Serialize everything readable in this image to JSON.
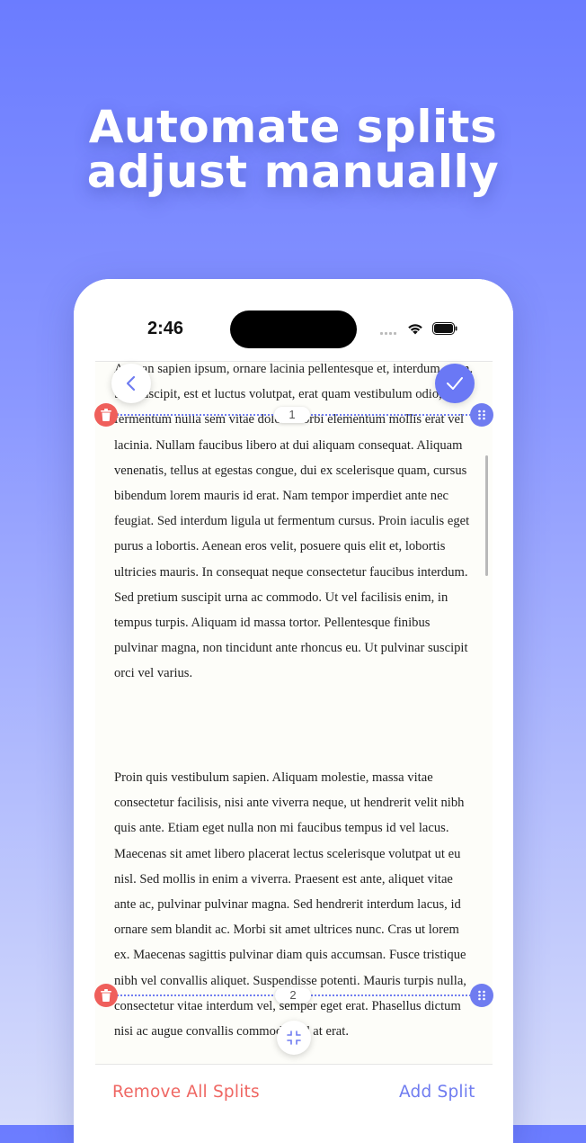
{
  "headline": {
    "line1": "Automate splits",
    "line2": "adjust manually"
  },
  "status_bar": {
    "time": "2:46"
  },
  "document": {
    "paragraph1": "Aenean sapien ipsum, ornare lacinia pellentesque et, interdum enim. Sed suscipit, est et luctus volutpat, erat quam vestibulum odio, et fermentum nulla sem vitae dolor. Morbi elementum mollis erat vel lacinia. Nullam faucibus libero at dui aliquam consequat. Aliquam venenatis, tellus at egestas congue, dui ex scelerisque quam, cursus bibendum lorem mauris id erat. Nam tempor imperdiet ante nec feugiat. Sed interdum ligula ut fermentum cursus. Proin iaculis eget purus a lobortis. Aenean eros velit, posuere quis elit et, lobortis ultricies mauris. In consequat neque consectetur faucibus interdum. Sed pretium suscipit urna ac commodo. Ut vel facilisis enim, in tempus turpis. Aliquam id massa tortor. Pellentesque finibus pulvinar magna, non tincidunt ante rhoncus eu. Ut pulvinar suscipit orci vel varius.",
    "paragraph2": "Proin quis vestibulum sapien. Aliquam molestie, massa vitae consectetur facilisis, nisi ante viverra neque, ut hendrerit velit nibh quis ante. Etiam eget nulla non mi faucibus tempus id vel lacus. Maecenas sit amet libero placerat lectus scelerisque volutpat ut eu nisl. Sed mollis in enim a viverra. Praesent est ante, aliquet vitae ante ac, pulvinar pulvinar magna. Sed hendrerit interdum lacus, id ornare sem blandit ac. Morbi sit amet ultrices nunc. Cras ut lorem ex. Maecenas sagittis pulvinar diam quis accumsan. Fusce tristique nibh vel convallis aliquet. Suspendisse potenti. Mauris turpis nulla, consectetur vitae interdum vel, semper eget erat. Phasellus dictum nisi ac augue convallis commodo sed at erat."
  },
  "splits": [
    {
      "number": "1"
    },
    {
      "number": "2"
    }
  ],
  "actions": {
    "remove_all": "Remove All Splits",
    "add_split": "Add Split"
  },
  "icons": {
    "back": "chevron-left-icon",
    "confirm": "checkmark-icon",
    "delete": "trash-icon",
    "drag": "drag-handle-icon",
    "compress": "compress-icon"
  },
  "colors": {
    "accent": "#6f7cf0",
    "danger": "#ef5f5b",
    "background_top": "#6b7cff",
    "background_bottom": "#d6dcfb"
  }
}
